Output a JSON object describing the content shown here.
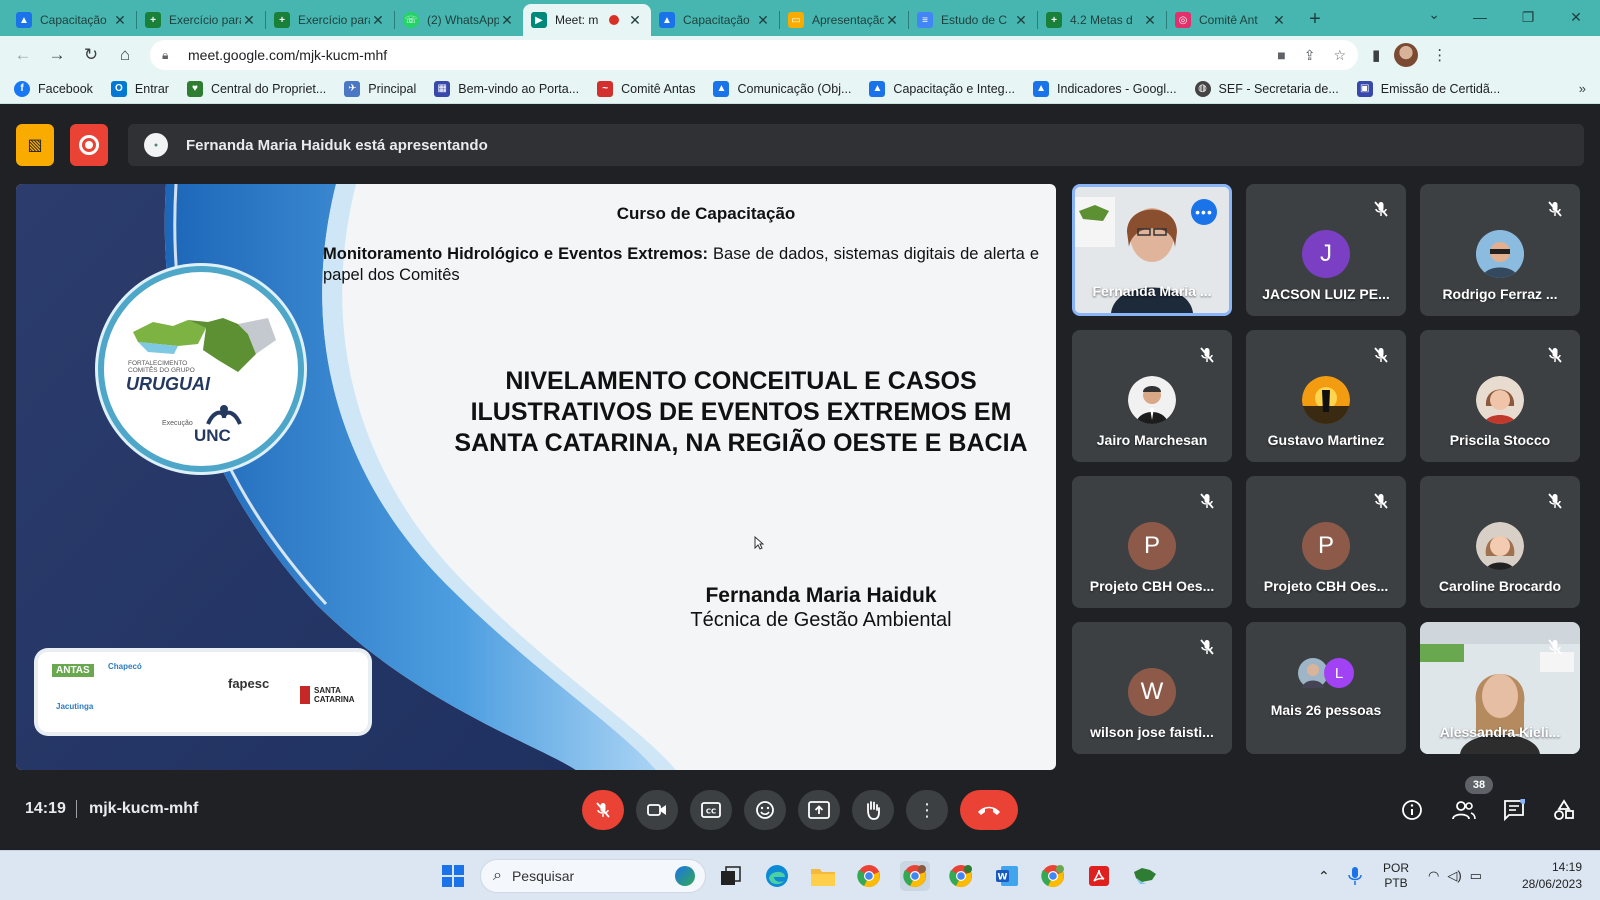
{
  "browser": {
    "tabs": [
      {
        "label": "Capacitação",
        "fav_color": "#1a73e8",
        "fav": "▲"
      },
      {
        "label": "Exercício para",
        "fav_color": "#188038",
        "fav": "+"
      },
      {
        "label": "Exercício para",
        "fav_color": "#188038",
        "fav": "+"
      },
      {
        "label": "(2) WhatsApp",
        "fav_color": "#25d366",
        "fav": "☏"
      },
      {
        "label": "Meet: m",
        "fav_color": "#00897b",
        "fav": "▶",
        "active": true
      },
      {
        "label": "Capacitação",
        "fav_color": "#1a73e8",
        "fav": "▲"
      },
      {
        "label": "Apresentação",
        "fav_color": "#f9ab00",
        "fav": "▭"
      },
      {
        "label": "Estudo de C",
        "fav_color": "#4285f4",
        "fav": "≡"
      },
      {
        "label": "4.2 Metas d",
        "fav_color": "#188038",
        "fav": "+"
      },
      {
        "label": "Comitê Ant",
        "fav_color": "#e1306c",
        "fav": "◎"
      }
    ],
    "url": "meet.google.com/mjk-kucm-mhf",
    "bookmarks": [
      {
        "label": "Facebook",
        "color": "#1877f2",
        "glyph": "f"
      },
      {
        "label": "Entrar",
        "color": "#0078d4",
        "glyph": "O"
      },
      {
        "label": "Central do Propriet...",
        "color": "#2e7d32",
        "glyph": "♥"
      },
      {
        "label": "Principal",
        "color": "#4a78c2",
        "glyph": "✈"
      },
      {
        "label": "Bem-vindo ao Porta...",
        "color": "#3949ab",
        "glyph": "▦"
      },
      {
        "label": "Comitê Antas",
        "color": "#d32f2f",
        "glyph": "~"
      },
      {
        "label": "Comunicação (Obj...",
        "color": "#1a73e8",
        "glyph": "▲"
      },
      {
        "label": "Capacitação e Integ...",
        "color": "#1a73e8",
        "glyph": "▲"
      },
      {
        "label": "Indicadores - Googl...",
        "color": "#1a73e8",
        "glyph": "▲"
      },
      {
        "label": "SEF - Secretaria de...",
        "color": "#444444",
        "glyph": "◍"
      },
      {
        "label": "Emissão de Certidã...",
        "color": "#3949ab",
        "glyph": "▣"
      }
    ]
  },
  "meet": {
    "presenting": "Fernanda Maria Haiduk está apresentando",
    "slide": {
      "course": "Curso de Capacitação",
      "subtitle_bold": "Monitoramento Hidrológico e Eventos Extremos:",
      "subtitle_rest": " Base de dados, sistemas digitais de alerta e papel dos Comitês",
      "main_title": "NIVELAMENTO CONCEITUAL  E CASOS ILUSTRATIVOS DE EVENTOS EXTREMOS EM SANTA CATARINA, NA REGIÃO OESTE E BACIA",
      "author": "Fernanda Maria Haiduk",
      "role": "Técnica de Gestão Ambiental",
      "logo_small": "FORTALECIMENTO COMITÊS DO GRUPO",
      "logo_main": "URUGUAI",
      "logo_exec": "Execução",
      "logo_unc": "UNC",
      "partners": [
        "ANTAS",
        "Chapecó",
        "Jacutinga",
        "fapesc",
        "SANTA CATARINA"
      ]
    },
    "participants": [
      {
        "name": "Fernanda Maria ...",
        "type": "video",
        "speaking": true
      },
      {
        "name": "JACSON LUIZ PE...",
        "initial": "J",
        "color": "#7b3fc4",
        "muted": true
      },
      {
        "name": "Rodrigo Ferraz ...",
        "type": "photo",
        "muted": true
      },
      {
        "name": "Jairo Marchesan",
        "type": "photo",
        "muted": true
      },
      {
        "name": "Gustavo Martinez",
        "type": "photo",
        "muted": true
      },
      {
        "name": "Priscila Stocco",
        "type": "photo",
        "muted": true
      },
      {
        "name": "Projeto CBH Oes...",
        "initial": "P",
        "color": "#8d5a4a",
        "muted": true
      },
      {
        "name": "Projeto CBH Oes...",
        "initial": "P",
        "color": "#8d5a4a",
        "muted": true
      },
      {
        "name": "Caroline Brocardo",
        "type": "photo",
        "muted": true
      },
      {
        "name": "wilson jose faisti...",
        "initial": "W",
        "color": "#8d5a4a",
        "muted": true
      },
      {
        "name": "Mais 26 pessoas",
        "type": "more",
        "initial": "L"
      },
      {
        "name": "Alessandra Kieli...",
        "type": "video",
        "muted": true
      }
    ],
    "time": "14:19",
    "code": "mjk-kucm-mhf",
    "people_count": "38"
  },
  "taskbar": {
    "search_placeholder": "Pesquisar",
    "lang1": "POR",
    "lang2": "PTB",
    "time": "14:19",
    "date": "28/06/2023"
  }
}
